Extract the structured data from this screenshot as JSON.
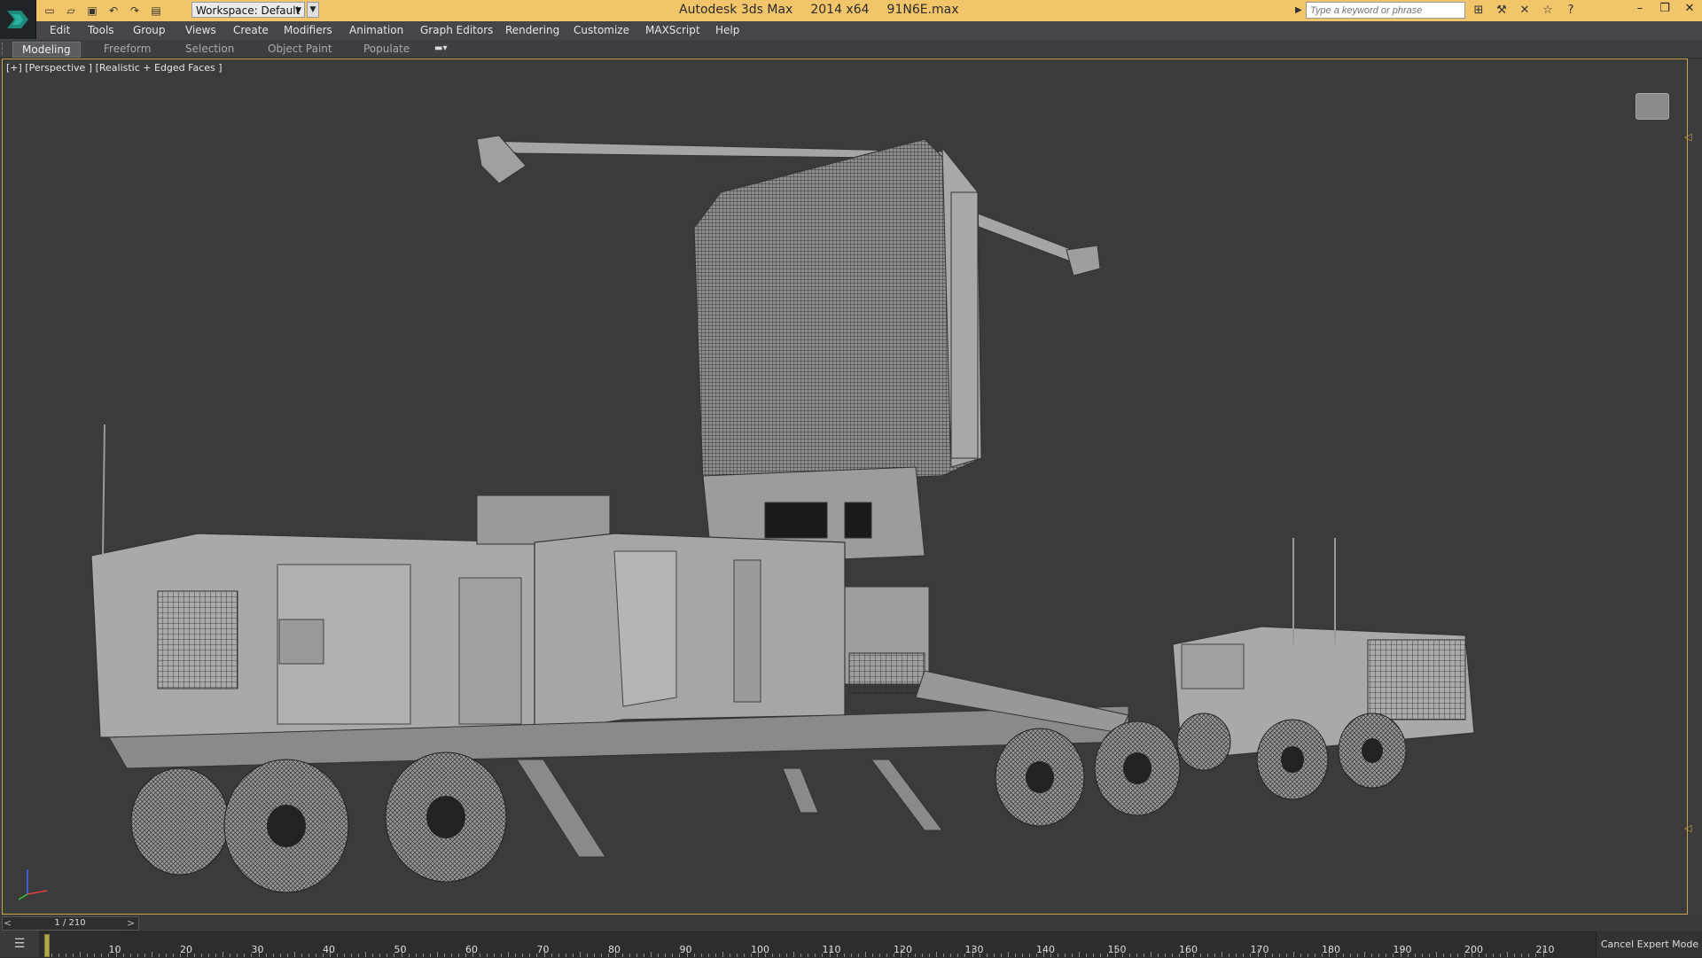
{
  "window": {
    "app": "Autodesk 3ds Max",
    "version": "2014 x64",
    "file": "91N6E.max"
  },
  "quick_access": {
    "workspace_label": "Workspace: Default",
    "icons": [
      "new-file-icon",
      "open-file-icon",
      "save-icon",
      "undo-icon",
      "redo-icon",
      "project-folder-icon"
    ]
  },
  "search": {
    "placeholder": "Type a keyword or phrase"
  },
  "info_center": {
    "icons": [
      "binoculars-icon",
      "tools-icon",
      "exchange-icon",
      "star-icon",
      "help-icon"
    ]
  },
  "menu": {
    "items": [
      "Edit",
      "Tools",
      "Group",
      "Views",
      "Create",
      "Modifiers",
      "Animation",
      "Graph Editors",
      "Rendering",
      "Customize",
      "MAXScript",
      "Help"
    ]
  },
  "ribbon": {
    "tabs": [
      "Modeling",
      "Freeform",
      "Selection",
      "Object Paint",
      "Populate"
    ],
    "active": "Modeling"
  },
  "viewport": {
    "label": "[+] [Perspective ] [Realistic + Edged Faces ]",
    "viewcube_face": "Top"
  },
  "time_slider": {
    "current": "1 / 210",
    "prev": "<",
    "next": ">"
  },
  "timeline": {
    "ticks": [
      "10",
      "20",
      "30",
      "40",
      "50",
      "60",
      "70",
      "80",
      "90",
      "100",
      "110",
      "120",
      "130",
      "140",
      "150",
      "160",
      "170",
      "180",
      "190",
      "200",
      "210"
    ]
  },
  "status": {
    "cancel_expert_mode": "Cancel Expert Mode"
  },
  "colors": {
    "title_bar": "#f2c56a",
    "viewport_border": "#c8a24a",
    "viewport_bg": "#3b3b3b"
  }
}
